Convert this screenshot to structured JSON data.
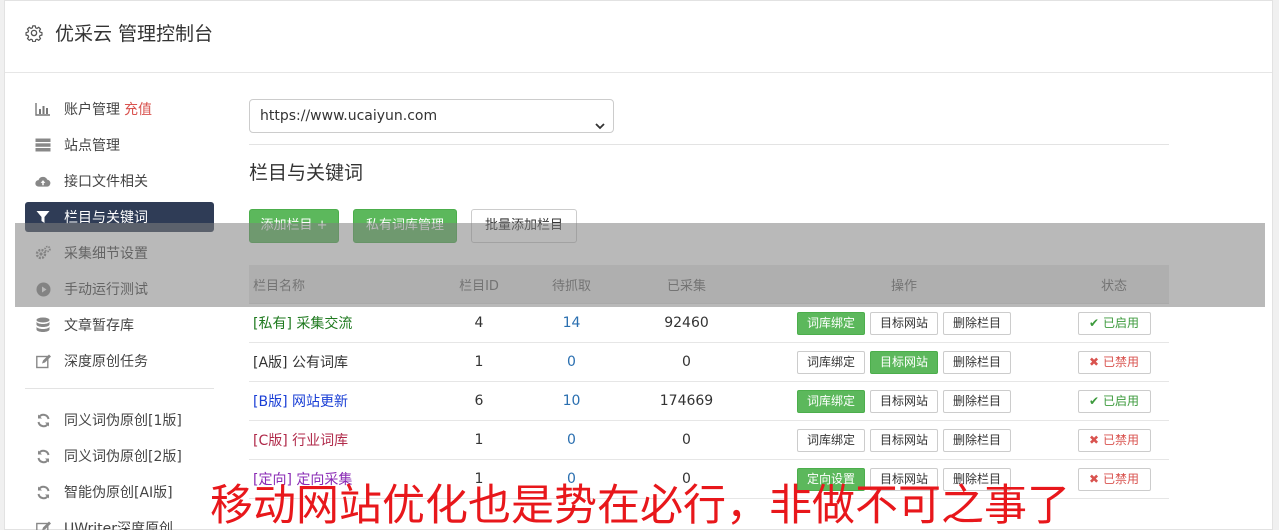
{
  "header": {
    "title": "优采云 管理控制台"
  },
  "sidebar": {
    "items": [
      {
        "label": "账户管理",
        "extra": "充值",
        "icon": "bar-chart-icon"
      },
      {
        "label": "站点管理",
        "icon": "server-icon"
      },
      {
        "label": "接口文件相关",
        "icon": "cloud-upload-icon"
      },
      {
        "label": "栏目与关键词",
        "icon": "filter-icon",
        "active": true
      },
      {
        "label": "采集细节设置",
        "icon": "cogs-icon"
      },
      {
        "label": "手动运行测试",
        "icon": "play-circle-icon"
      },
      {
        "label": "文章暂存库",
        "icon": "database-icon"
      },
      {
        "label": "深度原创任务",
        "icon": "edit-icon"
      }
    ],
    "items2": [
      {
        "label": "同义词伪原创[1版]",
        "icon": "refresh-icon"
      },
      {
        "label": "同义词伪原创[2版]",
        "icon": "refresh-icon"
      },
      {
        "label": "智能伪原创[AI版]",
        "icon": "refresh-icon"
      },
      {
        "label": "UWriter深度原创",
        "icon": "edit-icon"
      }
    ]
  },
  "main": {
    "site_select": "https://www.ucaiyun.com",
    "section_title": "栏目与关键词",
    "buttons": {
      "add": "添加栏目 +",
      "private_lib": "私有词库管理",
      "batch_add": "批量添加栏目"
    },
    "table": {
      "headers": {
        "name": "栏目名称",
        "id": "栏目ID",
        "pending": "待抓取",
        "collected": "已采集",
        "ops": "操作",
        "state": "状态"
      },
      "rows": [
        {
          "tag": "[私有]",
          "name": "采集交流",
          "id": "4",
          "pending": "14",
          "collected": "92460",
          "op1": "词库绑定",
          "op2": "目标网站",
          "op3": "删除栏目",
          "state": "已启用"
        },
        {
          "tag": "[A版]",
          "name": "公有词库",
          "id": "1",
          "pending": "0",
          "collected": "0",
          "op1": "词库绑定",
          "op2": "目标网站",
          "op3": "删除栏目",
          "state": "已禁用"
        },
        {
          "tag": "[B版]",
          "name": "网站更新",
          "id": "6",
          "pending": "10",
          "collected": "174669",
          "op1": "词库绑定",
          "op2": "目标网站",
          "op3": "删除栏目",
          "state": "已启用"
        },
        {
          "tag": "[C版]",
          "name": "行业词库",
          "id": "1",
          "pending": "0",
          "collected": "0",
          "op1": "词库绑定",
          "op2": "目标网站",
          "op3": "删除栏目",
          "state": "已禁用"
        },
        {
          "tag": "[定向]",
          "name": "定向采集",
          "id": "1",
          "pending": "0",
          "collected": "0",
          "op1": "定向设置",
          "op2": "目标网站",
          "op3": "删除栏目",
          "state": "已禁用"
        }
      ]
    }
  },
  "overlay_caption": "移动网站优化也是势在必行，非做不可之事了",
  "colors": {
    "accent_green": "#5cb85c",
    "active_nav": "#2f3c56",
    "danger": "#d9534f",
    "banner_red": "#e8171b"
  }
}
